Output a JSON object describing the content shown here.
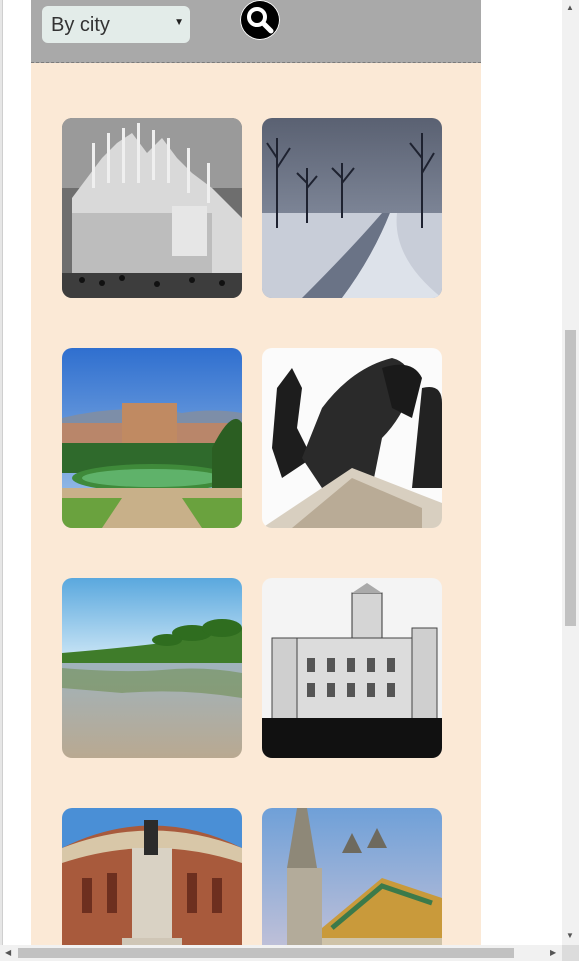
{
  "filter": {
    "selected_label": "By city"
  },
  "icons": {
    "search": "search-icon",
    "caret": "chevron-down-icon"
  },
  "colors": {
    "page_bg": "#fbe9d6",
    "toolbar_bg": "#a9a9a9",
    "select_bg": "#e3ece9"
  },
  "gallery": {
    "tiles": [
      {
        "subject": "milan-cathedral"
      },
      {
        "subject": "snowy-park-path"
      },
      {
        "subject": "florence-palace-garden"
      },
      {
        "subject": "bronze-horse-statue"
      },
      {
        "subject": "palm-beach-reflection"
      },
      {
        "subject": "madrid-city-palace"
      },
      {
        "subject": "royal-albert-hall"
      },
      {
        "subject": "budapest-church"
      }
    ]
  }
}
